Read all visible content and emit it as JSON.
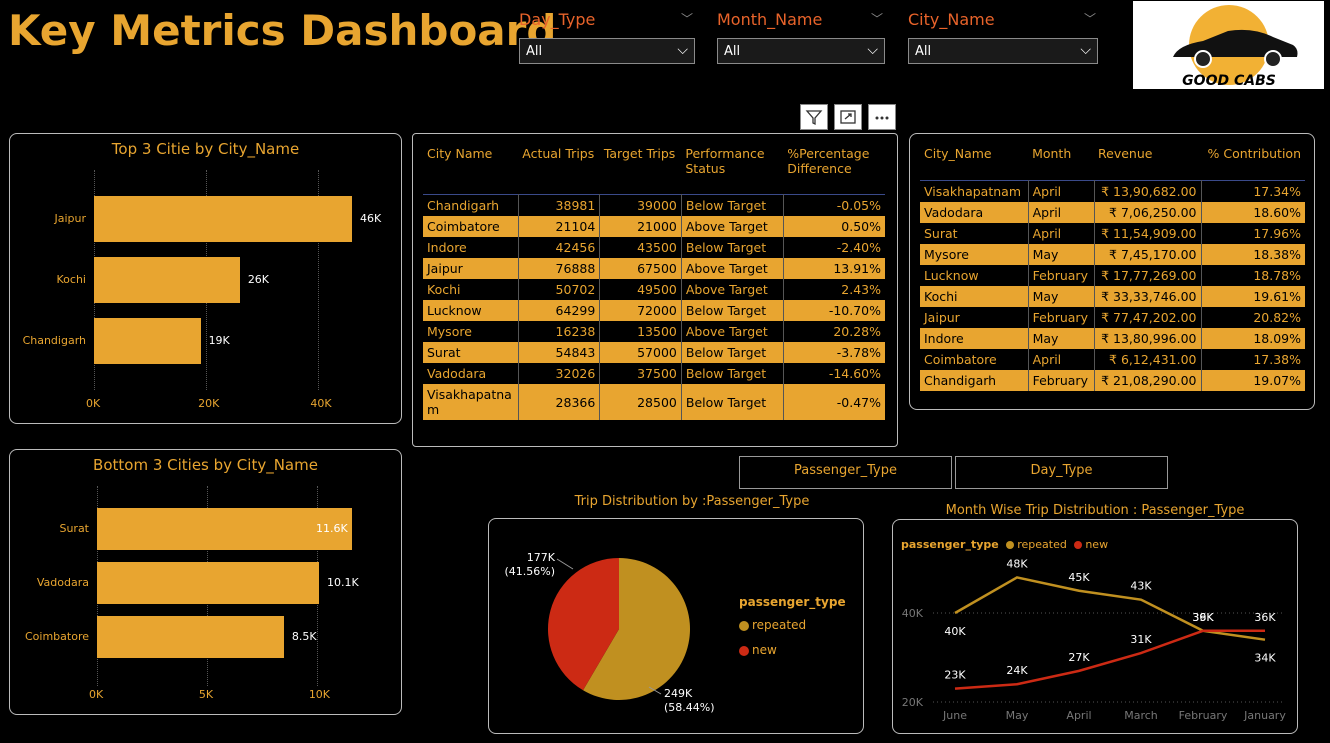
{
  "title": "Key Metrics Dashboard",
  "slicers": [
    {
      "label": "Day_Type",
      "value": "All"
    },
    {
      "label": "Month_Name",
      "value": "All"
    },
    {
      "label": "City_Name",
      "value": "All"
    }
  ],
  "logo": {
    "text": "GOOD CABS"
  },
  "top3": {
    "title": "Top 3 Citie by City_Name",
    "categories": [
      "Jaipur",
      "Kochi",
      "Chandigarh"
    ],
    "values": [
      46,
      26,
      19
    ],
    "labels": [
      "46K",
      "26K",
      "19K"
    ],
    "ticks": [
      "0K",
      "20K",
      "40K"
    ]
  },
  "bottom3": {
    "title": "Bottom 3 Cities by City_Name",
    "categories": [
      "Surat",
      "Vadodara",
      "Coimbatore"
    ],
    "values": [
      11.6,
      10.1,
      8.5
    ],
    "labels": [
      "11.6K",
      "10.1K",
      "8.5K"
    ],
    "ticks": [
      "0K",
      "5K",
      "10K"
    ]
  },
  "targets_table": {
    "headers": [
      "City Name",
      "Actual Trips",
      "Target Trips",
      "Performance Status",
      "%Percentage Difference"
    ],
    "rows": [
      [
        "Chandigarh",
        "38981",
        "39000",
        "Below Target",
        "-0.05%"
      ],
      [
        "Coimbatore",
        "21104",
        "21000",
        "Above Target",
        "0.50%"
      ],
      [
        "Indore",
        "42456",
        "43500",
        "Below Target",
        "-2.40%"
      ],
      [
        "Jaipur",
        "76888",
        "67500",
        "Above Target",
        "13.91%"
      ],
      [
        "Kochi",
        "50702",
        "49500",
        "Above Target",
        "2.43%"
      ],
      [
        "Lucknow",
        "64299",
        "72000",
        "Below Target",
        "-10.70%"
      ],
      [
        "Mysore",
        "16238",
        "13500",
        "Above Target",
        "20.28%"
      ],
      [
        "Surat",
        "54843",
        "57000",
        "Below Target",
        "-3.78%"
      ],
      [
        "Vadodara",
        "32026",
        "37500",
        "Below Target",
        "-14.60%"
      ],
      [
        "Visakhapatnam",
        "28366",
        "28500",
        "Below Target",
        "-0.47%"
      ]
    ]
  },
  "revenue_table": {
    "headers": [
      "City_Name",
      "Month",
      "Revenue",
      "% Contribution"
    ],
    "rows": [
      [
        "Visakhapatnam",
        "April",
        "₹ 13,90,682.00",
        "17.34%"
      ],
      [
        "Vadodara",
        "April",
        "₹ 7,06,250.00",
        "18.60%"
      ],
      [
        "Surat",
        "April",
        "₹ 11,54,909.00",
        "17.96%"
      ],
      [
        "Mysore",
        "May",
        "₹ 7,45,170.00",
        "18.38%"
      ],
      [
        "Lucknow",
        "February",
        "₹ 17,77,269.00",
        "18.78%"
      ],
      [
        "Kochi",
        "May",
        "₹ 33,33,746.00",
        "19.61%"
      ],
      [
        "Jaipur",
        "February",
        "₹ 77,47,202.00",
        "20.82%"
      ],
      [
        "Indore",
        "May",
        "₹ 13,80,996.00",
        "18.09%"
      ],
      [
        "Coimbatore",
        "April",
        "₹ 6,12,431.00",
        "17.38%"
      ],
      [
        "Chandigarh",
        "February",
        "₹ 21,08,290.00",
        "19.07%"
      ]
    ]
  },
  "buttons": {
    "passenger_type": "Passenger_Type",
    "day_type": "Day_Type"
  },
  "pie": {
    "title": "Trip Distribution by :Passenger_Type",
    "legend_title": "passenger_type",
    "slices": [
      {
        "name": "repeated",
        "value": 249,
        "label": "249K",
        "pct": "(58.44%)",
        "color": "#C09020"
      },
      {
        "name": "new",
        "value": 177,
        "label": "177K",
        "pct": "(41.56%)",
        "color": "#CC2A14"
      }
    ]
  },
  "line": {
    "title": "Month Wise Trip Distribution : Passenger_Type",
    "legend_title": "passenger_type",
    "categories": [
      "June",
      "May",
      "April",
      "March",
      "February",
      "January"
    ],
    "series": [
      {
        "name": "repeated",
        "color": "#C09020",
        "values": [
          40,
          48,
          45,
          43,
          36,
          34
        ],
        "labels": [
          "40K",
          "48K",
          "45K",
          "43K",
          "39K",
          "34K"
        ]
      },
      {
        "name": "new",
        "color": "#CC2A14",
        "values": [
          23,
          24,
          27,
          31,
          36,
          36
        ],
        "labels": [
          "23K",
          "24K",
          "27K",
          "31K",
          "36K",
          "36K"
        ]
      }
    ],
    "yticks": [
      "40K",
      "20K"
    ]
  },
  "chart_data": [
    {
      "type": "bar",
      "title": "Top 3 Citie by City_Name",
      "categories": [
        "Jaipur",
        "Kochi",
        "Chandigarh"
      ],
      "values": [
        46000,
        26000,
        19000
      ],
      "xlim": [
        0,
        48000
      ]
    },
    {
      "type": "bar",
      "title": "Bottom 3 Cities by City_Name",
      "categories": [
        "Surat",
        "Vadodara",
        "Coimbatore"
      ],
      "values": [
        11600,
        10100,
        8500
      ],
      "xlim": [
        0,
        12000
      ]
    },
    {
      "type": "pie",
      "title": "Trip Distribution by :Passenger_Type",
      "categories": [
        "repeated",
        "new"
      ],
      "values": [
        249000,
        177000
      ]
    },
    {
      "type": "line",
      "title": "Month Wise Trip Distribution : Passenger_Type",
      "x": [
        "June",
        "May",
        "April",
        "March",
        "February",
        "January"
      ],
      "series": [
        {
          "name": "repeated",
          "values": [
            40000,
            48000,
            45000,
            43000,
            39000,
            34000
          ]
        },
        {
          "name": "new",
          "values": [
            23000,
            24000,
            27000,
            31000,
            36000,
            36000
          ]
        }
      ]
    }
  ]
}
